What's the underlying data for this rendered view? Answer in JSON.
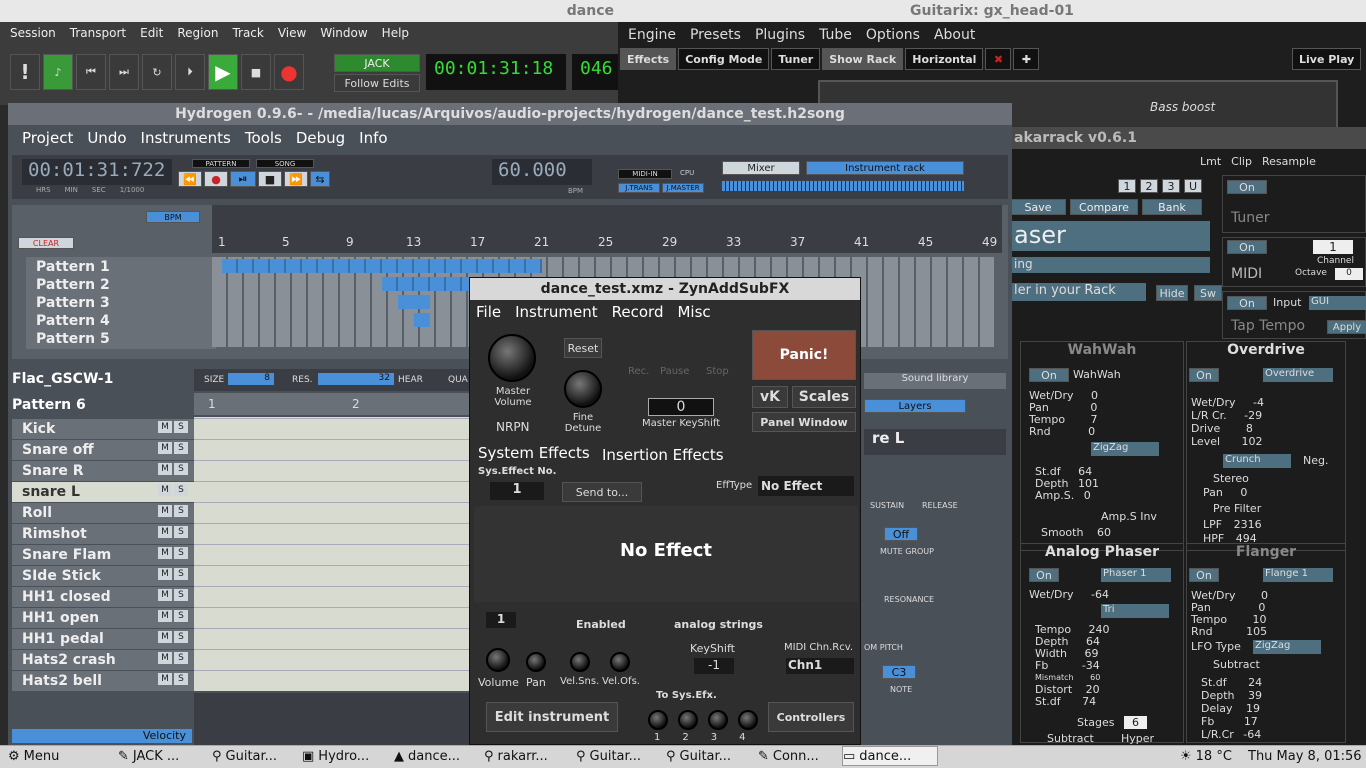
{
  "ardour": {
    "title": "dance",
    "menu": [
      "Session",
      "Transport",
      "Edit",
      "Region",
      "Track",
      "View",
      "Window",
      "Help"
    ],
    "jack": "JACK",
    "follow_edits": "Follow Edits",
    "clock": "00:01:31:18",
    "tempo_val": "046",
    "jack_label": "JACK",
    "tempo_label": "Tempo"
  },
  "guitarix": {
    "title": "Guitarix: gx_head-01",
    "menu": [
      "Engine",
      "Presets",
      "Plugins",
      "Tube",
      "Options",
      "About"
    ],
    "toolbar": [
      "Effects",
      "Config Mode",
      "Tuner",
      "Show Rack",
      "Horizontal"
    ],
    "live_play": "Live Play",
    "bass_boost": "Bass boost"
  },
  "rakarrack": {
    "title": "akarrack v0.6.1",
    "lmt": "Lmt",
    "clip": "Clip",
    "resample": "Resample",
    "save": "Save",
    "compare": "Compare",
    "bank": "Bank",
    "on": "On",
    "tuner": "Tuner",
    "preset_name": "aser",
    "ing": "ing",
    "your_rack": "ler in your Rack",
    "hide": "Hide",
    "sw": "Sw",
    "midi": "MIDI",
    "channel": "Channel",
    "channel_val": "1",
    "octave": "Octave",
    "octave_val": "0",
    "input": "Input",
    "input_val": "GUI",
    "tap_tempo": "Tap Tempo",
    "apply": "Apply",
    "nums": [
      "1",
      "2",
      "3",
      "U"
    ],
    "wahwah": {
      "name": "WahWah",
      "preset": "WahWah",
      "params": [
        [
          "Wet/Dry",
          "0"
        ],
        [
          "Pan",
          "0"
        ],
        [
          "Tempo",
          "7"
        ],
        [
          "Rnd",
          "0"
        ]
      ],
      "lfo": "ZigZag",
      "params2": [
        [
          "St.df",
          "64"
        ],
        [
          "Depth",
          "101"
        ],
        [
          "Amp.S.",
          "0"
        ]
      ],
      "amps_inv": "Amp.S Inv",
      "smooth": [
        "Smooth",
        "60"
      ]
    },
    "overdrive": {
      "name": "Overdrive",
      "preset": "Overdrive",
      "params": [
        [
          "Wet/Dry",
          "-4"
        ],
        [
          "L/R Cr.",
          "-29"
        ],
        [
          "Drive",
          "8"
        ],
        [
          "Level",
          "102"
        ]
      ],
      "type": "Crunch",
      "neg": "Neg.",
      "stereo": "Stereo",
      "pan": [
        "Pan",
        "0"
      ],
      "prefilter": "Pre Filter",
      "lpf": [
        "LPF",
        "2316"
      ],
      "hpf": [
        "HPF",
        "494"
      ]
    },
    "aphaser": {
      "name": "Analog Phaser",
      "preset": "Phaser 1",
      "params": [
        [
          "Wet/Dry",
          "-64"
        ]
      ],
      "lfo": "Tri",
      "params2": [
        [
          "Tempo",
          "240"
        ],
        [
          "Depth",
          "64"
        ],
        [
          "Width",
          "69"
        ],
        [
          "Fb",
          "-34"
        ],
        [
          "Mismatch",
          "60"
        ],
        [
          "Distort",
          "20"
        ],
        [
          "St.df",
          "74"
        ]
      ],
      "stages": "Stages",
      "stages_val": "6",
      "subtract": "Subtract",
      "hyper": "Hyper"
    },
    "flanger": {
      "name": "Flanger",
      "preset": "Flange 1",
      "params": [
        [
          "Wet/Dry",
          "0"
        ],
        [
          "Pan",
          "0"
        ],
        [
          "Tempo",
          "10"
        ],
        [
          "Rnd",
          "105"
        ]
      ],
      "lfo": "ZigZag",
      "subtract": "Subtract",
      "params2": [
        [
          "St.df",
          "24"
        ],
        [
          "Depth",
          "39"
        ],
        [
          "Delay",
          "19"
        ],
        [
          "Fb",
          "17"
        ],
        [
          "L/R.Cr",
          "-64"
        ]
      ]
    }
  },
  "hydrogen": {
    "title": "Hydrogen 0.9.6- - /media/lucas/Arquivos/audio-projects/hydrogen/dance_test.h2song",
    "menu": [
      "Project",
      "Undo",
      "Instruments",
      "Tools",
      "Debug",
      "Info"
    ],
    "clock": "00:01:31:722",
    "clock_units": [
      "HRS",
      "MIN",
      "SEC",
      "1/1000"
    ],
    "pattern": "PATTERN",
    "song": "SONG",
    "bpm": "60.000",
    "bpm_lbl": "BPM",
    "midi_in": "MIDI-IN",
    "cpu": "CPU",
    "jtrans": "J.TRANS",
    "jmaster": "J.MASTER",
    "mixer": "Mixer",
    "instrument_rack": "Instrument rack",
    "bpm_btn": "BPM",
    "clear": "CLEAR",
    "ruler": [
      "1",
      "5",
      "9",
      "13",
      "17",
      "21",
      "25",
      "29",
      "33",
      "37",
      "41",
      "45",
      "49"
    ],
    "patterns": [
      "Pattern 1",
      "Pattern 2",
      "Pattern 3",
      "Pattern 4",
      "Pattern 5"
    ],
    "drumkit": "Flac_GSCW-1",
    "size": "SIZE",
    "size_val": "8",
    "res": "RES.",
    "res_val": "32",
    "hear": "HEAR",
    "qua": "QUA",
    "pattern6": "Pattern 6",
    "beat": [
      "1",
      "2"
    ],
    "instruments": [
      "Kick",
      "Snare off",
      "Snare R",
      "snare L",
      "Roll",
      "Rimshot",
      "Snare Flam",
      "SIde Stick",
      "HH1 closed",
      "HH1 open",
      "HH1 pedal",
      "Hats2 crash",
      "Hats2 bell"
    ],
    "velocity": "Velocity",
    "sound_library": "Sound library",
    "layers": "Layers",
    "inst_name": "re L",
    "sustain": "SUSTAIN",
    "release": "RELEASE",
    "off": "Off",
    "mute_group": "MUTE GROUP",
    "resonance": "RESONANCE",
    "pitch": "OM PITCH",
    "note_val": "C3",
    "note": "NOTE",
    "m": "M",
    "s": "S"
  },
  "zyn": {
    "title": "dance_test.xmz - ZynAddSubFX",
    "menu": [
      "File",
      "Instrument",
      "Record",
      "Misc"
    ],
    "reset": "Reset",
    "rec": "Rec.",
    "pause": "Pause",
    "stop": "Stop",
    "panic": "Panic!",
    "master_volume": "Master Volume",
    "fine_detune": "Fine Detune",
    "nrpn": "NRPN",
    "keyshift_val": "0",
    "master_keyshift": "Master KeyShift",
    "vk": "vK",
    "scales": "Scales",
    "panel_window": "Panel Window",
    "sys_effects": "System Effects",
    "ins_effects": "Insertion Effects",
    "sys_eff_no": "Sys.Effect No.",
    "eff_no": "1",
    "send_to": "Send to...",
    "efftype": "EffType",
    "efftype_val": "No Effect",
    "no_effect": "No Effect",
    "part_no": "1",
    "enabled": "Enabled",
    "part_name": "analog strings",
    "keyshift": "KeyShift",
    "keyshift2": "-1",
    "midi_chn": "MIDI Chn.Rcv.",
    "chn": "Chn1",
    "volume": "Volume",
    "pan": "Pan",
    "velsns": "Vel.Sns.",
    "velofs": "Vel.Ofs.",
    "to_sys": "To Sys.Efx.",
    "sys_nums": [
      "1",
      "2",
      "3",
      "4"
    ],
    "edit_instrument": "Edit instrument",
    "controllers": "Controllers"
  },
  "taskbar": {
    "menu": "Menu",
    "items": [
      "JACK ...",
      "Guitar...",
      "Hydro...",
      "dance...",
      "rakarr...",
      "Guitar...",
      "Guitar...",
      "Conn...",
      "dance..."
    ],
    "weather": "18 °C",
    "datetime": "Thu May  8, 01:56"
  },
  "colors": {
    "hydrogen_bg": "#4a5058",
    "hydrogen_blue": "#4a90d9",
    "zyn_bg": "#2e2e2e",
    "panic": "#8b4a3a",
    "rak_bg": "#1c1c1c"
  }
}
